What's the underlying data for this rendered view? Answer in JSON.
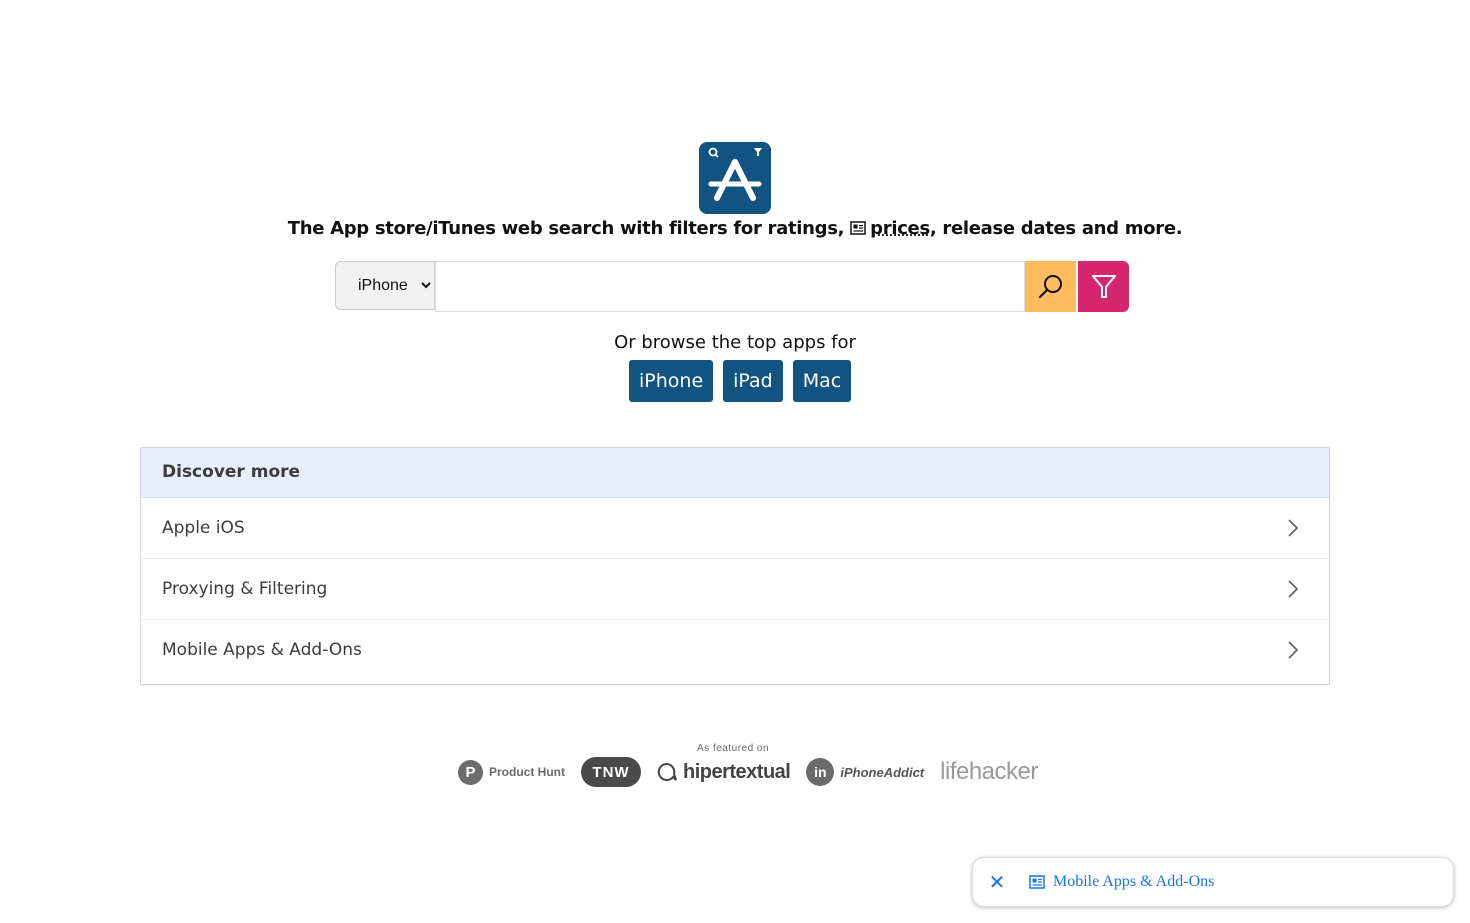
{
  "logo": {
    "icon": "app-store-filter-icon",
    "bg_color": "#125481"
  },
  "tagline": {
    "before": "The App store/iTunes web search with filters for ratings, ",
    "prices_link": "prices",
    "after": ", release dates and more."
  },
  "search": {
    "device_selected": "iPhone",
    "device_options": [
      "iPhone"
    ],
    "query_value": "",
    "search_button_color": "#ffbc5e",
    "filter_button_color": "#d6266e"
  },
  "browse": {
    "label": "Or browse the top apps for",
    "buttons": [
      "iPhone",
      "iPad",
      "Mac"
    ],
    "button_color": "#125481"
  },
  "discover": {
    "title": "Discover more",
    "items": [
      "Apple iOS",
      "Proxying & Filtering",
      "Mobile Apps & Add-Ons"
    ]
  },
  "press": {
    "label": "As featured on",
    "product_hunt": {
      "letter": "P",
      "name": "Product Hunt"
    },
    "tnw": "TNW",
    "hipertextual": "hipertextual",
    "iphoneaddict": {
      "letter": "in",
      "name": "iPhoneAddict"
    },
    "lifehacker": "lifehacker"
  },
  "toast": {
    "close_symbol": "✕",
    "link_text": "Mobile Apps & Add-Ons"
  }
}
